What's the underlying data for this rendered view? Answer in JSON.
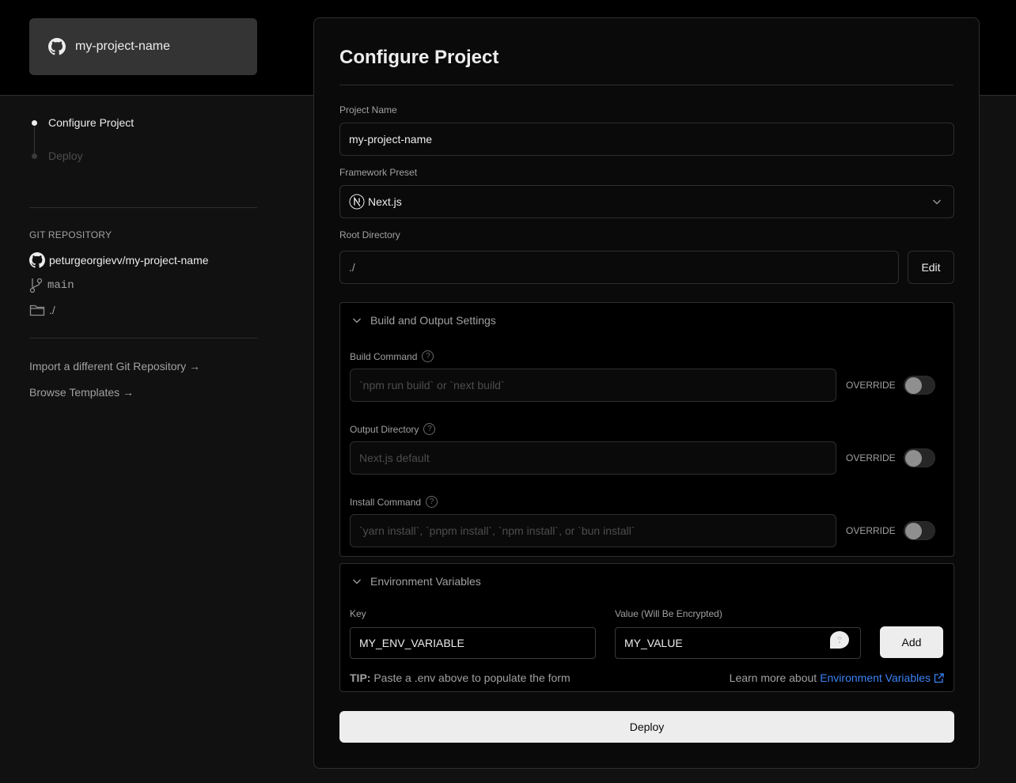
{
  "sidebar": {
    "repo_card": {
      "name": "my-project-name",
      "icon": "github-icon"
    },
    "steps": [
      {
        "label": "Configure Project",
        "active": true
      },
      {
        "label": "Deploy",
        "active": false
      }
    ],
    "git": {
      "title": "GIT REPOSITORY",
      "repo": "peturgeorgievv/my-project-name",
      "branch": "main",
      "directory": "./"
    },
    "links": [
      {
        "label": "Import a different Git Repository →"
      },
      {
        "label": "Browse Templates →"
      }
    ]
  },
  "main": {
    "title": "Configure Project",
    "project_name": {
      "label": "Project Name",
      "value": "my-project-name"
    },
    "framework": {
      "label": "Framework Preset",
      "value": "Next.js",
      "icon": "nextjs-icon"
    },
    "root_dir": {
      "label": "Root Directory",
      "value": "./",
      "edit_label": "Edit"
    },
    "build_section": {
      "title": "Build and Output Settings",
      "fields": [
        {
          "label": "Build Command",
          "placeholder": "`npm run build` or `next build`",
          "override_label": "OVERRIDE",
          "override_on": false
        },
        {
          "label": "Output Directory",
          "placeholder": "Next.js default",
          "override_label": "OVERRIDE",
          "override_on": false
        },
        {
          "label": "Install Command",
          "placeholder": "`yarn install`, `pnpm install`, `npm install`, or `bun install`",
          "override_label": "OVERRIDE",
          "override_on": false
        }
      ]
    },
    "env_section": {
      "title": "Environment Variables",
      "key_label": "Key",
      "key_value": "MY_ENV_VARIABLE",
      "value_label": "Value (Will Be Encrypted)",
      "value_value": "MY_VALUE",
      "add_label": "Add",
      "tip_bold": "TIP:",
      "tip_text": "Paste a .env above to populate the form",
      "learn_prefix": "Learn more about",
      "learn_link": "Environment Variables"
    },
    "deploy_label": "Deploy"
  },
  "colors": {
    "accent_link": "#3b82f6",
    "button_light": "#ededed",
    "background": "#111111"
  }
}
